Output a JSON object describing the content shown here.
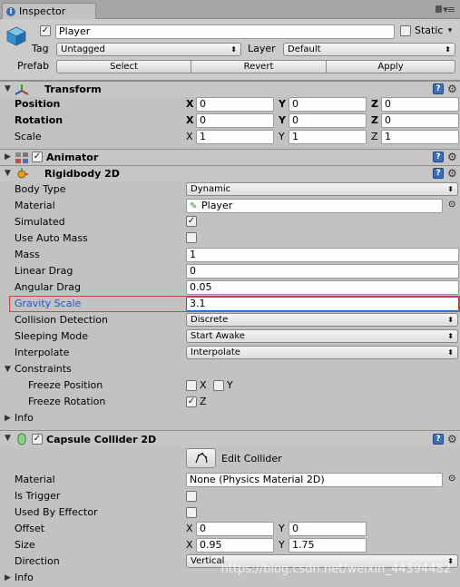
{
  "tab": {
    "label": "Inspector"
  },
  "header": {
    "object_name": "Player",
    "static_label": "Static",
    "tag_label": "Tag",
    "tag_value": "Untagged",
    "layer_label": "Layer",
    "layer_value": "Default",
    "prefab_label": "Prefab",
    "select": "Select",
    "revert": "Revert",
    "apply": "Apply"
  },
  "transform": {
    "title": "Transform",
    "position_label": "Position",
    "rotation_label": "Rotation",
    "scale_label": "Scale",
    "axis_x": "X",
    "axis_y": "Y",
    "axis_z": "Z",
    "position": {
      "x": "0",
      "y": "0",
      "z": "0"
    },
    "rotation": {
      "x": "0",
      "y": "0",
      "z": "0"
    },
    "scale": {
      "x": "1",
      "y": "1",
      "z": "1"
    }
  },
  "animator": {
    "title": "Animator"
  },
  "rigidbody": {
    "title": "Rigidbody 2D",
    "body_type_label": "Body Type",
    "body_type": "Dynamic",
    "material_label": "Material",
    "material": "Player",
    "simulated_label": "Simulated",
    "use_auto_mass_label": "Use Auto Mass",
    "mass_label": "Mass",
    "mass": "1",
    "linear_drag_label": "Linear Drag",
    "linear_drag": "0",
    "angular_drag_label": "Angular Drag",
    "angular_drag": "0.05",
    "gravity_scale_label": "Gravity Scale",
    "gravity_scale": "3.1",
    "collision_detection_label": "Collision Detection",
    "collision_detection": "Discrete",
    "sleeping_mode_label": "Sleeping Mode",
    "sleeping_mode": "Start Awake",
    "interpolate_label": "Interpolate",
    "interpolate": "Interpolate",
    "constraints_label": "Constraints",
    "freeze_position_label": "Freeze Position",
    "freeze_rotation_label": "Freeze Rotation",
    "x": "X",
    "y": "Y",
    "z": "Z",
    "info_label": "Info"
  },
  "capsule": {
    "title": "Capsule Collider 2D",
    "edit_collider": "Edit Collider",
    "material_label": "Material",
    "material": "None (Physics Material 2D)",
    "is_trigger_label": "Is Trigger",
    "used_by_effector_label": "Used By Effector",
    "offset_label": "Offset",
    "offset": {
      "x": "0",
      "y": "0"
    },
    "size_label": "Size",
    "size": {
      "x": "0.95",
      "y": "1.75"
    },
    "direction_label": "Direction",
    "direction": "Vertical",
    "info_label": "Info",
    "axis_x": "X",
    "axis_y": "Y"
  },
  "watermark": "https://blog.csdn.net/weixin_44394482"
}
